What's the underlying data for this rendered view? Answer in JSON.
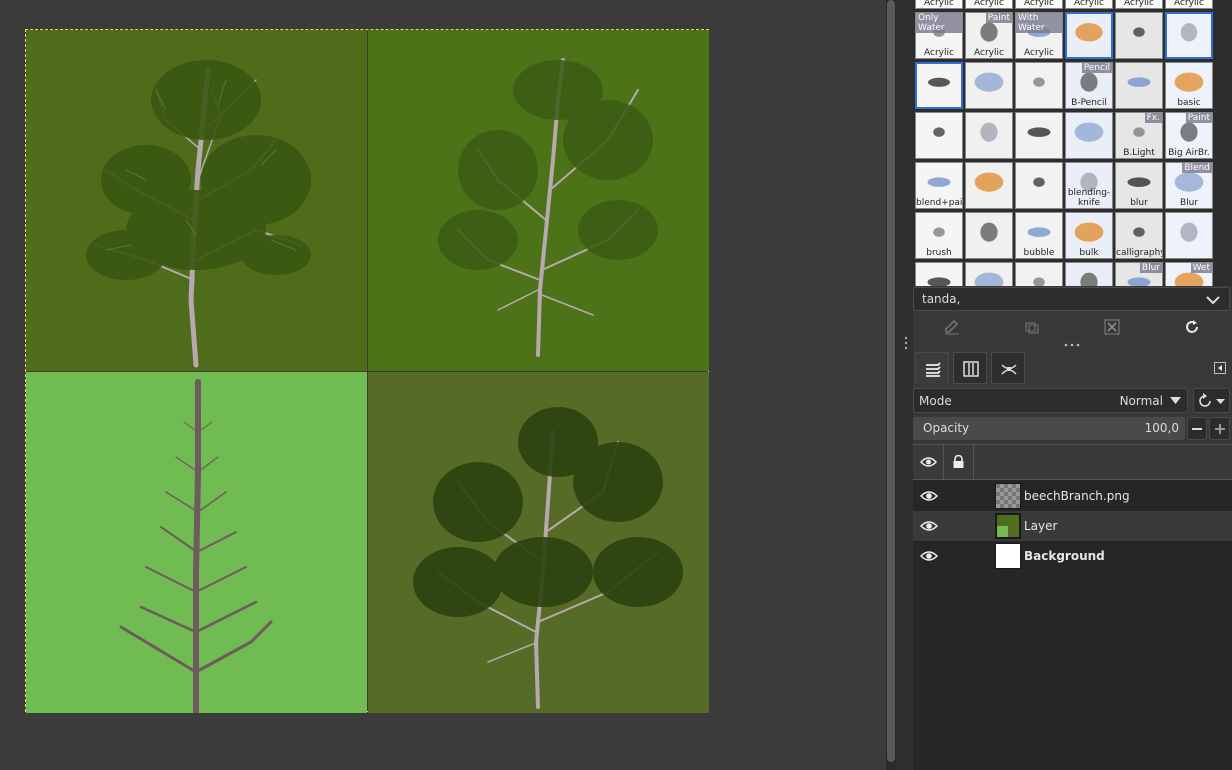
{
  "brushes": {
    "row0_labels": [
      "Acrylic",
      "Acrylic",
      "Acrylic",
      "Acrylic",
      "Acrylic",
      "Acrylic"
    ],
    "items": [
      {
        "label": "Acrylic",
        "tag": "Only Water"
      },
      {
        "label": "Acrylic",
        "tag": "Paint"
      },
      {
        "label": "Acrylic",
        "tag": "With Water"
      },
      {
        "label": "",
        "tag": ""
      },
      {
        "label": "",
        "tag": ""
      },
      {
        "label": "",
        "tag": ""
      },
      {
        "label": "",
        "tag": ""
      },
      {
        "label": "",
        "tag": ""
      },
      {
        "label": "",
        "tag": ""
      },
      {
        "label": "B-Pencil",
        "tag": "Pencil"
      },
      {
        "label": "",
        "tag": ""
      },
      {
        "label": "basic",
        "tag": ""
      },
      {
        "label": "",
        "tag": ""
      },
      {
        "label": "",
        "tag": ""
      },
      {
        "label": "",
        "tag": ""
      },
      {
        "label": "",
        "tag": ""
      },
      {
        "label": "B.Light",
        "tag": "Fx."
      },
      {
        "label": "Big AirBr.",
        "tag": "Paint"
      },
      {
        "label": "blend+paint",
        "tag": ""
      },
      {
        "label": "",
        "tag": ""
      },
      {
        "label": "",
        "tag": ""
      },
      {
        "label": "blending-knife",
        "tag": ""
      },
      {
        "label": "blur",
        "tag": ""
      },
      {
        "label": "Blur",
        "tag": "Blend"
      },
      {
        "label": "brush",
        "tag": ""
      },
      {
        "label": "",
        "tag": ""
      },
      {
        "label": "bubble",
        "tag": ""
      },
      {
        "label": "bulk",
        "tag": ""
      },
      {
        "label": "calligraphy",
        "tag": ""
      },
      {
        "label": "",
        "tag": ""
      },
      {
        "label": "",
        "tag": ""
      },
      {
        "label": "",
        "tag": ""
      },
      {
        "label": "",
        "tag": ""
      },
      {
        "label": "",
        "tag": ""
      },
      {
        "label": "",
        "tag": "Blur"
      },
      {
        "label": "",
        "tag": "Wet"
      }
    ],
    "filter_value": "tanda,"
  },
  "layers_panel": {
    "mode_label": "Mode",
    "mode_value": "Normal",
    "opacity_label": "Opacity",
    "opacity_value": "100,0",
    "layers": [
      {
        "name": "beechBranch.png",
        "bold": false,
        "selected": false
      },
      {
        "name": "Layer",
        "bold": false,
        "selected": true
      },
      {
        "name": "Background",
        "bold": true,
        "selected": false
      }
    ]
  },
  "colors": {
    "quad_top_left": "#4f6c1b",
    "quad_top_right": "#4d7319",
    "quad_bottom_left": "#70bb52",
    "quad_bottom_right": "#566c26",
    "selection": "#2f6fd6"
  }
}
